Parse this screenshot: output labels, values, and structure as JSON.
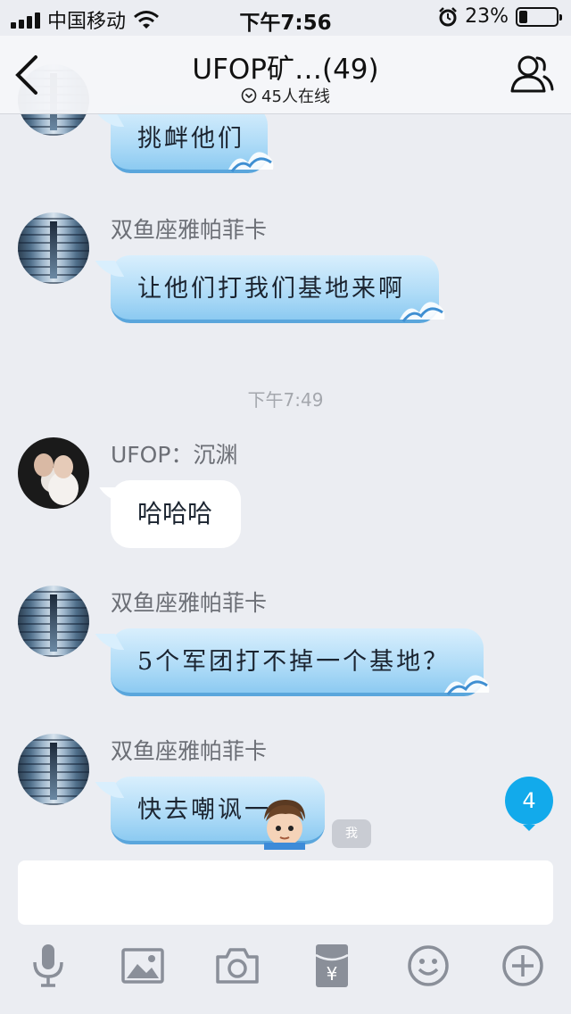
{
  "status_bar": {
    "carrier": "中国移动",
    "time": "下午7:56",
    "battery_percent": "23%",
    "battery_level": 0.23
  },
  "nav": {
    "title": "UFOP矿…(49)",
    "online": "45人在线",
    "icons": [
      "back-chevron-icon",
      "members-icon",
      "online-indicator-icon"
    ]
  },
  "messages": [
    {
      "sender": "",
      "text": "挑衅他们",
      "style": "blue"
    },
    {
      "sender": "双鱼座雅帕菲卡",
      "text": "让他们打我们基地来啊",
      "style": "blue"
    },
    {
      "sender": "UFOP：沉渊",
      "text": "哈哈哈",
      "style": "white"
    },
    {
      "sender": "双鱼座雅帕菲卡",
      "text": "5个军团打不掉一个基地？",
      "style": "blue"
    },
    {
      "sender": "双鱼座雅帕菲卡",
      "text": "快去嘲讽一",
      "style": "blue"
    }
  ],
  "timestamp": "下午7:49",
  "unread_count": "4",
  "me_tag": "我",
  "input": {
    "value": ""
  },
  "toolbar_icons": [
    "microphone-icon",
    "image-icon",
    "camera-icon",
    "red-packet-icon",
    "emoji-icon",
    "plus-icon"
  ],
  "colors": {
    "accent": "#12aaeb",
    "bubble_blue": "#aedbf7",
    "background": "#ebedf2"
  }
}
